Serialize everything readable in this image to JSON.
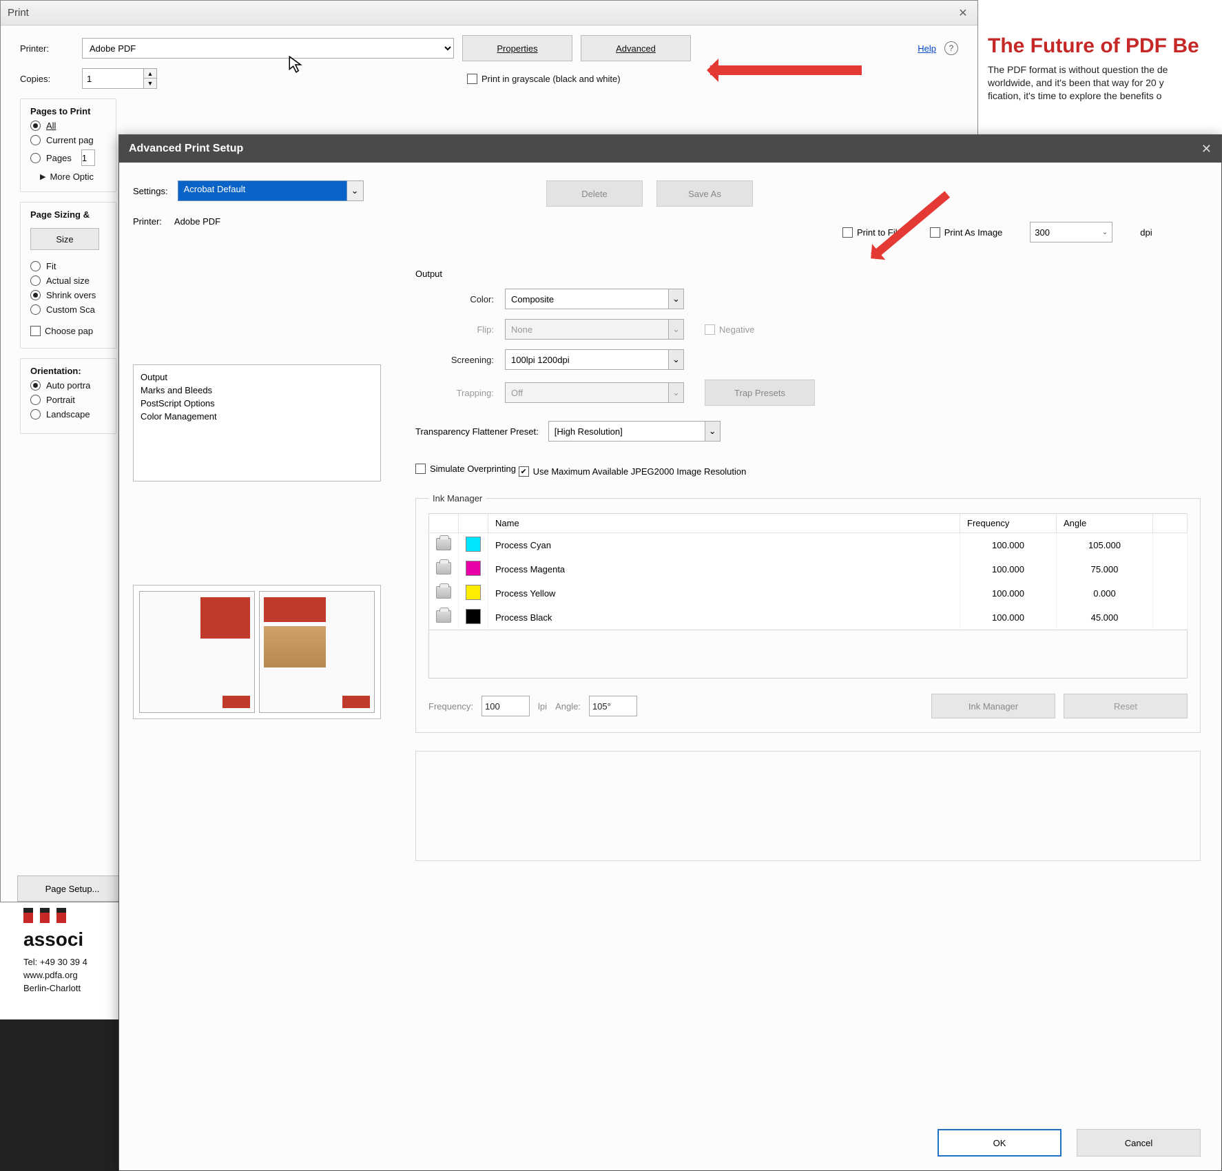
{
  "background": {
    "headline": "The Future of PDF Be",
    "body1": "The PDF format is without question the de",
    "body2": "worldwide, and it's been that way for 20 y",
    "body3": "fication, it's time to explore the benefits o",
    "logo_text": "associ",
    "contact1": "Tel: +49 30 39 4",
    "contact2": "www.pdfa.org",
    "contact3": "Berlin-Charlott"
  },
  "print": {
    "title": "Print",
    "printer_label": "Printer:",
    "printer_value": "Adobe PDF",
    "properties_btn": "Properties",
    "advanced_btn": "Advanced",
    "help": "Help",
    "copies_label": "Copies:",
    "copies_value": "1",
    "grayscale": "Print in grayscale (black and white)",
    "pages_group": "Pages to Print",
    "all": "All",
    "current": "Current pag",
    "pages": "Pages",
    "pages_val": "1",
    "more": "More Optic",
    "sizing_group": "Page Sizing &",
    "size_btn": "Size",
    "fit": "Fit",
    "actual": "Actual size",
    "shrink": "Shrink overs",
    "custom": "Custom Sca",
    "choose": "Choose pap",
    "orient_group": "Orientation:",
    "auto": "Auto portra",
    "portrait": "Portrait",
    "landscape": "Landscape",
    "page_setup": "Page Setup..."
  },
  "adv": {
    "title": "Advanced Print Setup",
    "settings_label": "Settings:",
    "settings_value": "Acrobat Default",
    "delete_btn": "Delete",
    "saveas_btn": "Save As",
    "printer_label": "Printer:",
    "printer_value": "Adobe PDF",
    "print_to_file": "Print to File",
    "print_as_image": "Print As Image",
    "dpi_value": "300",
    "dpi_label": "dpi",
    "categories": [
      "Output",
      "Marks and Bleeds",
      "PostScript Options",
      "Color Management"
    ],
    "output_label": "Output",
    "color_label": "Color:",
    "color_value": "Composite",
    "flip_label": "Flip:",
    "flip_value": "None",
    "negative": "Negative",
    "screening_label": "Screening:",
    "screening_value": "100lpi 1200dpi",
    "trapping_label": "Trapping:",
    "trapping_value": "Off",
    "trap_presets": "Trap Presets",
    "flattener_label": "Transparency Flattener Preset:",
    "flattener_value": "[High Resolution]",
    "simulate": "Simulate Overprinting",
    "max_jpeg": "Use Maximum Available JPEG2000 Image Resolution",
    "ink_manager_title": "Ink Manager",
    "col_name": "Name",
    "col_freq": "Frequency",
    "col_angle": "Angle",
    "inks": [
      {
        "name": "Process Cyan",
        "freq": "100.000",
        "angle": "105.000",
        "color": "#00e5ff"
      },
      {
        "name": "Process Magenta",
        "freq": "100.000",
        "angle": "75.000",
        "color": "#e600a8"
      },
      {
        "name": "Process Yellow",
        "freq": "100.000",
        "angle": "0.000",
        "color": "#ffee00"
      },
      {
        "name": "Process Black",
        "freq": "100.000",
        "angle": "45.000",
        "color": "#000000"
      }
    ],
    "freq_label": "Frequency:",
    "freq_value": "100",
    "lpi": "lpi",
    "angle_label": "Angle:",
    "angle_value": "105°",
    "ink_mgr_btn": "Ink Manager",
    "reset_btn": "Reset",
    "ok": "OK",
    "cancel": "Cancel"
  }
}
